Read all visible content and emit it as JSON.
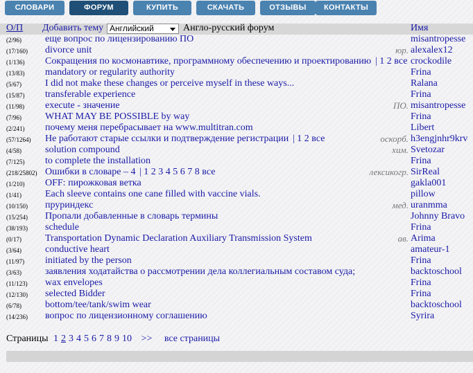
{
  "nav": [
    {
      "label": "СЛОВАРИ",
      "active": false
    },
    {
      "label": "ФОРУМ",
      "active": true
    },
    {
      "label": "КУПИТЬ",
      "active": false
    },
    {
      "label": "СКАЧАТЬ",
      "active": false
    },
    {
      "label": "ОТЗЫВЫ",
      "active": false
    },
    {
      "label": "КОНТАКТЫ",
      "active": false
    }
  ],
  "header": {
    "op": "О/П",
    "add_topic": "Добавить тему",
    "language": "Английский",
    "forum_title": "Англо-русский форум",
    "name_col": "Имя"
  },
  "rows": [
    {
      "count": "(2/96)",
      "topic": "еще вопрос по лицензированию ПО",
      "pages": "",
      "tag": "",
      "author": "misantropesse"
    },
    {
      "count": "(17/160)",
      "topic": "divorce unit",
      "pages": "",
      "tag": "юр.",
      "author": "alexalex12"
    },
    {
      "count": "(1/136)",
      "topic": "Сокращения по космонавтике, программному обеспечению и проектированию",
      "pages": "| 1 2 все",
      "tag": "",
      "author": "crockodile"
    },
    {
      "count": "(13/83)",
      "topic": "mandatory or regularity authority",
      "pages": "",
      "tag": "",
      "author": "Frina"
    },
    {
      "count": "(5/67)",
      "topic": "I did not make these changes or perceive myself in these ways...",
      "pages": "",
      "tag": "",
      "author": "Ralana"
    },
    {
      "count": "(15/87)",
      "topic": "transferable experience",
      "pages": "",
      "tag": "",
      "author": "Frina"
    },
    {
      "count": "(11/98)",
      "topic": "execute - значение",
      "pages": "",
      "tag": "ПО.",
      "author": "misantropesse"
    },
    {
      "count": "(7/96)",
      "topic": "WHAT MAY BE POSSIBLE by way",
      "pages": "",
      "tag": "",
      "author": "Frina"
    },
    {
      "count": "(2/241)",
      "topic": "почему меня перебрасывает на www.multitran.com",
      "pages": "",
      "tag": "",
      "author": "Libert"
    },
    {
      "count": "(57/1264)",
      "topic": "Не работают старые ссылки и подтверждение регистрации",
      "pages": "| 1 2 все",
      "tag": "оскорб.",
      "author": "h3engjnhr9krv"
    },
    {
      "count": "(4/58)",
      "topic": "solution compound",
      "pages": "",
      "tag": "хим.",
      "author": "Svetozar"
    },
    {
      "count": "(7/125)",
      "topic": "to complete the installation",
      "pages": "",
      "tag": "",
      "author": "Frina"
    },
    {
      "count": "(218/25802)",
      "topic": "Ошибки в словаре – 4",
      "pages": "| 1 2 3 4 5 6 7 8 все",
      "tag": "лексикогр.",
      "author": "SirReal"
    },
    {
      "count": "(1/210)",
      "topic": "OFF: пирожковая ветка",
      "pages": "",
      "tag": "",
      "author": "gakla001"
    },
    {
      "count": "(1/41)",
      "topic": "Each sleeve contains one cane filled with vaccine vials.",
      "pages": "",
      "tag": "",
      "author": "pillow"
    },
    {
      "count": "(10/150)",
      "topic": "пруриндекс",
      "pages": "",
      "tag": "мед.",
      "author": "uranmma"
    },
    {
      "count": "(15/254)",
      "topic": "Пропали добавленные в словарь термины",
      "pages": "",
      "tag": "",
      "author": "Johnny Bravo"
    },
    {
      "count": "(38/193)",
      "topic": "schedule",
      "pages": "",
      "tag": "",
      "author": "Frina"
    },
    {
      "count": "(0/17)",
      "topic": "Transportation Dynamic Declaration Auxiliary Transmission System",
      "pages": "",
      "tag": "ав.",
      "author": "Arima"
    },
    {
      "count": "(3/64)",
      "topic": "conductive heart",
      "pages": "",
      "tag": "",
      "author": "amateur-1"
    },
    {
      "count": "(11/97)",
      "topic": "initiated by the person",
      "pages": "",
      "tag": "",
      "author": "Frina"
    },
    {
      "count": "(3/63)",
      "topic": "заявления ходатайства о рассмотрении дела коллегиальным составом суда;",
      "pages": "",
      "tag": "",
      "author": "backtoschool"
    },
    {
      "count": "(11/123)",
      "topic": "wax envelopes",
      "pages": "",
      "tag": "",
      "author": "Frina"
    },
    {
      "count": "(12/130)",
      "topic": "selected Bidder",
      "pages": "",
      "tag": "",
      "author": "Frina"
    },
    {
      "count": "(6/78)",
      "topic": "bottom/tee/tank/swim wear",
      "pages": "",
      "tag": "",
      "author": "backtoschool"
    },
    {
      "count": "(14/236)",
      "topic": "вопрос по лицензионному соглашению",
      "pages": "",
      "tag": "",
      "author": "Syrira"
    }
  ],
  "pager": {
    "label": "Страницы",
    "pages": [
      "1",
      "2",
      "3",
      "4",
      "5",
      "6",
      "7",
      "8",
      "9",
      "10"
    ],
    "current": "2",
    "next": ">>",
    "all": "все страницы"
  }
}
